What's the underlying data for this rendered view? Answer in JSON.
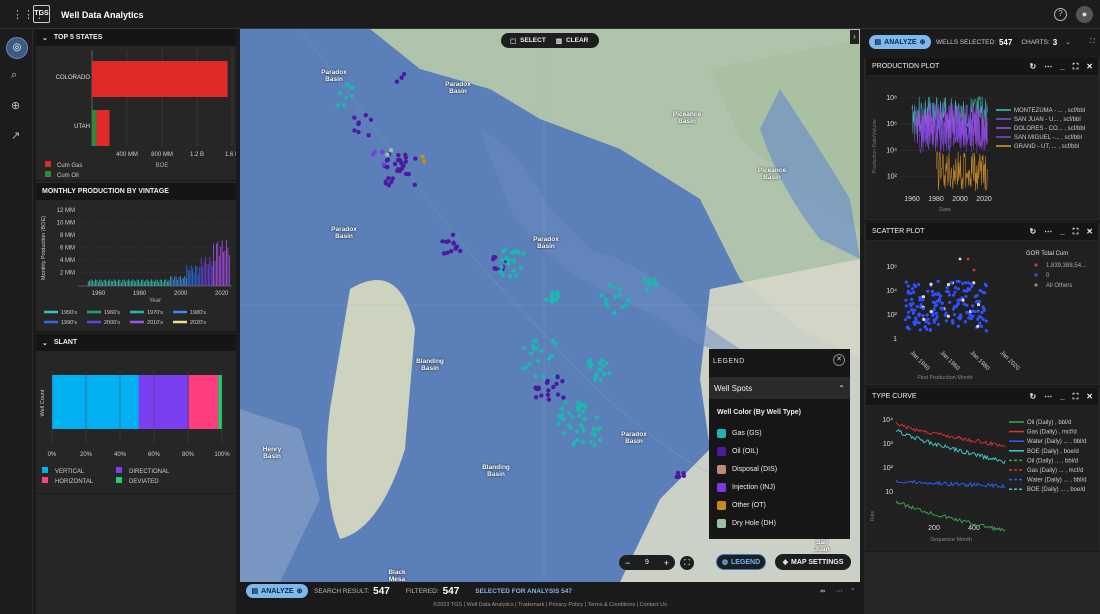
{
  "app": {
    "logo": "TGS",
    "title": "Well Data Analytics"
  },
  "top5": {
    "title": "TOP 5 STATES",
    "states": [
      {
        "name": "COLORADO",
        "gas": 1.55
      },
      {
        "name": "UTAH",
        "gas": 0.2,
        "oil": 0.05
      }
    ],
    "ticks": [
      "400 MM",
      "800 MM",
      "1.2 B",
      "1.6 B"
    ],
    "xlabel": "BOE",
    "legend": [
      {
        "label": "Cum Gas",
        "color": "#e02a2a"
      },
      {
        "label": "Cum Oil",
        "color": "#2e8b3e"
      }
    ]
  },
  "vintage": {
    "title": "MONTHLY PRODUCTION BY VINTAGE",
    "ylabel": "Monthly Production (BOE)",
    "yticks": [
      "12 MM",
      "10 MM",
      "8 MM",
      "6 MM",
      "4 MM",
      "2 MM"
    ],
    "xticks": [
      "1960",
      "1980",
      "2000",
      "2020"
    ],
    "xlabel": "Year",
    "legend": [
      {
        "label": "1950's",
        "color": "#2ec4b6"
      },
      {
        "label": "1960's",
        "color": "#1f9e89"
      },
      {
        "label": "1970's",
        "color": "#24b8b0"
      },
      {
        "label": "1980's",
        "color": "#3a8ee6"
      },
      {
        "label": "1990's",
        "color": "#2b6be0"
      },
      {
        "label": "2000's",
        "color": "#6a3fe0"
      },
      {
        "label": "2010's",
        "color": "#a64ff0"
      },
      {
        "label": "2020's",
        "color": "#f0e08a"
      }
    ]
  },
  "slant": {
    "title": "SLANT",
    "ylabel": "Well Count",
    "xticks": [
      "0%",
      "20%",
      "40%",
      "60%",
      "80%",
      "100%"
    ],
    "shares": [
      {
        "label": "VERTICAL",
        "value": 47,
        "color": "#00b0f0"
      },
      {
        "label": "DIRECTIONAL",
        "value": 27,
        "color": "#7b3ff2"
      },
      {
        "label": "HORIZONTAL",
        "value": 16,
        "color": "#ff3d7f"
      },
      {
        "label": "DEVIATED",
        "value": 2,
        "color": "#1ecf6a"
      }
    ]
  },
  "map": {
    "select": "SELECT",
    "clear": "CLEAR",
    "zoom": "9",
    "legend_btn": "LEGEND",
    "settings_btn": "MAP SETTINGS",
    "labels": [
      "Paradox Basin",
      "Paradox Basin",
      "Paradox Basin",
      "Paradox Basin",
      "Piceance Basin",
      "Piceance Basin",
      "Paradox Basin",
      "Blanding Basin",
      "Blanding Basin",
      "Henry Basin",
      "San Juan",
      "Black Mesa"
    ]
  },
  "legend": {
    "title": "LEGEND",
    "section": "Well Spots",
    "subtitle": "Well Color (By Well Type)",
    "items": [
      {
        "label": "Gas (GS)",
        "color": "#1fb5b0"
      },
      {
        "label": "Oil (OIL)",
        "color": "#4b1aa0"
      },
      {
        "label": "Disposal (DIS)",
        "color": "#c08a7a"
      },
      {
        "label": "Injection (INJ)",
        "color": "#7c3ae6"
      },
      {
        "label": "Other (OT)",
        "color": "#c88a20"
      },
      {
        "label": "Dry Hole (DH)",
        "color": "#9fc0a8"
      }
    ]
  },
  "bottom": {
    "analyze": "ANALYZE",
    "search_label": "SEARCH RESULT:",
    "search_value": "547",
    "filtered_label": "FILTERED:",
    "filtered_value": "547",
    "selected": "SELECTED FOR ANALYSIS 547",
    "footer": "©2023 TGS | Well Data Analytics | Trademark | Privacy Policy | Terms & Conditions | Contact Us"
  },
  "right": {
    "analyze": "ANALYZE",
    "wells_label": "WELLS SELECTED:",
    "wells_value": "547",
    "charts_label": "CHARTS:",
    "charts_value": "3"
  },
  "prod": {
    "title": "PRODUCTION PLOT",
    "yticks": [
      "10⁸",
      "10⁶",
      "10⁴",
      "10²"
    ],
    "xticks": [
      "1960",
      "1980",
      "2000",
      "2020"
    ],
    "xlabel": "Date",
    "ylabel": "Production Rate/Volume",
    "legend": [
      {
        "label": "MONTEZUMA - ... , scf/bbl",
        "color": "#3ec9c0"
      },
      {
        "label": "SAN JUAN - U... , scf/bbl",
        "color": "#8a4ae8"
      },
      {
        "label": "DOLORES - CO... , scf/bbl",
        "color": "#b04fe0"
      },
      {
        "label": "SAN MIGUEL -... , scf/bbl",
        "color": "#7a48e0"
      },
      {
        "label": "GRAND - UT, ... , scf/bbl",
        "color": "#e09a2a"
      }
    ]
  },
  "scatter": {
    "title": "SCATTER PLOT",
    "yticks": [
      "10⁶",
      "10⁴",
      "10²",
      "1"
    ],
    "xticks": [
      "Jan 1940",
      "Jan 1960",
      "Jan 1980",
      "Jan 2020"
    ],
    "xlabel": "First Production Month",
    "legend_title": "GOR Total Cum",
    "legend": [
      {
        "label": "1,839,388,54...",
        "color": "#e03030"
      },
      {
        "label": "0",
        "color": "#3050ff"
      },
      {
        "label": "All Others",
        "color": "#888"
      }
    ]
  },
  "typecurve": {
    "title": "TYPE CURVE",
    "yticks": [
      "10⁴",
      "10³",
      "10²",
      "10"
    ],
    "xticks": [
      "200",
      "400"
    ],
    "xlabel": "Sequence Month",
    "ylabel": "Rate",
    "legend": [
      {
        "label": "Oil (Daily) , bbl/d",
        "color": "#3aa650",
        "dash": false
      },
      {
        "label": "Gas (Daily) , mcf/d",
        "color": "#e03030",
        "dash": false
      },
      {
        "label": "Water (Daily) ... , bbl/d",
        "color": "#3060ff",
        "dash": false
      },
      {
        "label": "BOE (Daily) , boe/d",
        "color": "#40d0d0",
        "dash": false
      },
      {
        "label": "Oil (Daily) ... , bbl/d",
        "color": "#3aa650",
        "dash": true
      },
      {
        "label": "Gas (Daily) ... , mcf/d",
        "color": "#e03030",
        "dash": true
      },
      {
        "label": "Water (Daily) ... , bbl/d",
        "color": "#3060ff",
        "dash": true
      },
      {
        "label": "BOE (Daily) ... , boe/d",
        "color": "#40d0d0",
        "dash": true
      }
    ]
  }
}
